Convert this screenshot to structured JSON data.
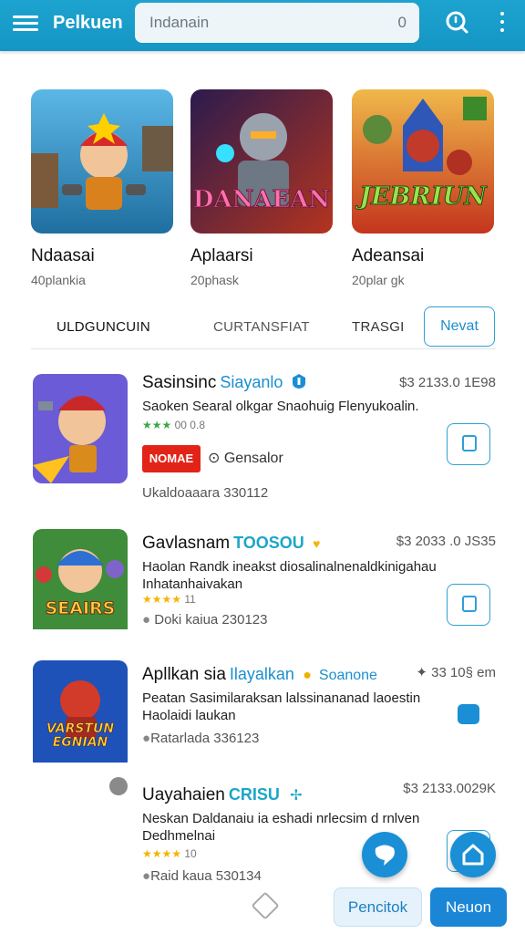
{
  "header": {
    "title": "Pelkuen",
    "search_value": "Indanain",
    "search_suffix": "0"
  },
  "featured": [
    {
      "name": "Ndaasai",
      "meta": "40plankia"
    },
    {
      "name": "Aplaarsi",
      "meta": "20phask",
      "art_text": "DANAEAN"
    },
    {
      "name": "Adeansai",
      "meta": "20plar gk",
      "art_text": "JEBRIUN"
    }
  ],
  "tabs": [
    "ULDGUNCUIN",
    "CURTANSFIAT",
    "TRASGI",
    "Nevat"
  ],
  "list": [
    {
      "title": "Sasinsinc",
      "tag": "Siayanlo",
      "price": "$3 2133.0 1E98",
      "desc": "Saoken Searal olkgar Snaohuig Flenyukoalin.",
      "stars": "★★★",
      "stars_text": "00 0.8",
      "badge": "NOMAE",
      "badge_text": "Gensalor",
      "info": "Ukaldoaaara 330112"
    },
    {
      "title": "Gavlasnam",
      "tag": "TOOSOU",
      "price": "$3 2033 .0 JS35",
      "desc": "Haolan Randk ineakst diosalinalnenaldkinigahau Inhatanhaivakan",
      "stars": "★★★★",
      "stars_text": "11",
      "info": "Doki kaiua 230123",
      "art_text": "SEAIRS"
    },
    {
      "title": "Apllkan sia",
      "tag": "Ilayalkan",
      "tag2": "Soanone",
      "price": "33 10§ em",
      "desc": "Peatan Sasimilaraksan lalssinananad laoestin Haolaidi laukan",
      "info": "Ratarlada 336123",
      "art_text": "VARSTUN EGNIAN"
    },
    {
      "title": "Uayahaien",
      "tag": "CRISU",
      "price": "$3 2133.0029K",
      "desc": "Neskan Daldanaiu ia eshadi nrlecsim d rnlven Dedhmelnai",
      "stars": "★★★★",
      "stars_text": "10",
      "info": "Raid kaua 530134"
    }
  ],
  "buttons": {
    "secondary": "Pencitok",
    "primary": "Neuon"
  },
  "colors": {
    "accent": "#1a8fd6",
    "topbar": "#1da3cf",
    "star": "#f5b400",
    "badge": "#e22318"
  }
}
